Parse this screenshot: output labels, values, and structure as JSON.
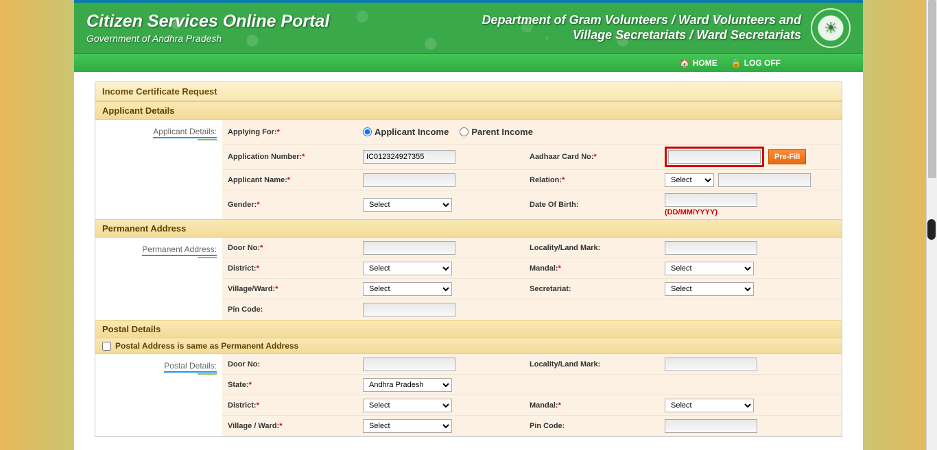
{
  "banner": {
    "title": "Citizen Services Online Portal",
    "subtitle": "Government of Andhra Pradesh",
    "dept_line1": "Department of Gram Volunteers / Ward Volunteers and",
    "dept_line2": "Village Secretariats / Ward Secretariats"
  },
  "nav": {
    "home": "HOME",
    "logoff": "LOG OFF"
  },
  "page": {
    "title": "Income Certificate Request"
  },
  "sections": {
    "applicant": {
      "head": "Applicant Details",
      "side": "Applicant Details:",
      "applying_for_label": "Applying For:",
      "radio1": "Applicant Income",
      "radio2": "Parent Income",
      "app_no_label": "Application Number:",
      "app_no_value": "IC012324927355",
      "aadhaar_label": "Aadhaar Card No:",
      "prefill_btn": "Pre-Fill",
      "name_label": "Applicant Name:",
      "relation_label": "Relation:",
      "relation_default": "Select",
      "gender_label": "Gender:",
      "gender_default": "Select",
      "dob_label": "Date Of Birth:",
      "dob_hint": "(DD/MM/YYYY)"
    },
    "perm": {
      "head": "Permanent Address",
      "side": "Permanent Address:",
      "door_label": "Door No:",
      "locality_label": "Locality/Land Mark:",
      "district_label": "District:",
      "district_default": "Select",
      "mandal_label": "Mandal:",
      "mandal_default": "Select",
      "village_label": "Village/Ward:",
      "village_default": "Select",
      "secretariat_label": "Secretariat:",
      "secretariat_default": "Select",
      "pin_label": "Pin Code:"
    },
    "postal": {
      "head": "Postal Details",
      "same_checkbox": "Postal Address is same as Permanent Address",
      "side": "Postal Details:",
      "door_label": "Door No:",
      "locality_label": "Locality/Land Mark:",
      "state_label": "State:",
      "state_default": "Andhra Pradesh",
      "district_label": "District:",
      "district_default": "Select",
      "mandal_label": "Mandal:",
      "mandal_default": "Select",
      "village_label": "Village / Ward:",
      "village_default": "Select",
      "pin_label": "Pin Code:"
    }
  }
}
